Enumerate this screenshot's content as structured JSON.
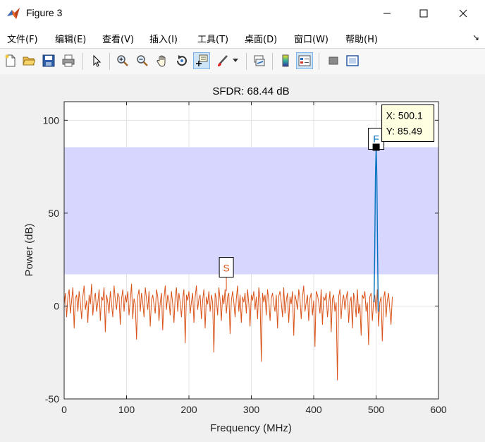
{
  "window": {
    "title": "Figure 3",
    "icon": "matlab-icon",
    "controls": [
      "minimize-icon",
      "maximize-icon",
      "close-icon"
    ]
  },
  "menu": {
    "items": [
      {
        "label": "文件(F)"
      },
      {
        "label": "编辑(E)"
      },
      {
        "label": "查看(V)"
      },
      {
        "label": "插入(I)"
      },
      {
        "label": "工具(T)"
      },
      {
        "label": "桌面(D)"
      },
      {
        "label": "窗口(W)"
      },
      {
        "label": "帮助(H)"
      }
    ],
    "overflow": "↘"
  },
  "toolbar": {
    "tools": [
      "new-figure-icon",
      "open-file-icon",
      "save-icon",
      "print-icon",
      "pointer-icon",
      "zoom-in-icon",
      "zoom-out-icon",
      "pan-icon",
      "rotate-icon",
      "data-cursor-icon",
      "brush-icon",
      "brush-dropdown-icon",
      "link-plot-icon",
      "colorbar-icon",
      "legend-icon",
      "hide-plot-tools-icon",
      "show-plot-tools-icon"
    ],
    "active": "data-cursor-icon"
  },
  "chart_data": {
    "type": "line",
    "title": "SFDR:  68.44 dB",
    "xlabel": "Frequency (MHz)",
    "ylabel": "Power (dB)",
    "xlim": [
      0,
      600
    ],
    "ylim": [
      -50,
      110
    ],
    "xticks": [
      "0",
      "100",
      "200",
      "300",
      "400",
      "500",
      "600"
    ],
    "yticks": [
      "-50",
      "0",
      "50",
      "100"
    ],
    "grid": true,
    "colors": {
      "noise": "#d95319",
      "signal": "#0072bd",
      "band": "#d6d6ff"
    },
    "sfdr_band": {
      "y_low": 17.05,
      "y_high": 85.49
    },
    "signal": {
      "x": 500.1,
      "y": 85.49,
      "marker": "F"
    },
    "spur": {
      "x": 260,
      "y": 17.05,
      "marker": "S"
    },
    "datatip": {
      "x_label": "X: 500.1",
      "y_label": "Y: 85.49"
    },
    "noise_series": {
      "x_start": 0,
      "x_step": 2,
      "values": [
        1,
        7,
        -6,
        5,
        9,
        -4,
        3,
        10,
        -12,
        4,
        6,
        -3,
        8,
        2,
        -7,
        5,
        11,
        -2,
        3,
        -9,
        6,
        1,
        12,
        -5,
        4,
        7,
        -3,
        2,
        9,
        -8,
        5,
        3,
        10,
        -14,
        6,
        2,
        -4,
        8,
        1,
        -6,
        11,
        3,
        -2,
        7,
        5,
        -10,
        4,
        9,
        -3,
        6,
        2,
        8,
        -5,
        3,
        12,
        -7,
        4,
        1,
        -18,
        5,
        9,
        -3,
        7,
        2,
        -6,
        10,
        4,
        -2,
        8,
        -11,
        3,
        6,
        1,
        -4,
        9,
        5,
        -8,
        2,
        7,
        -13,
        4,
        11,
        -2,
        6,
        3,
        -5,
        8,
        1,
        -9,
        5,
        10,
        -3,
        7,
        2,
        -6,
        4,
        9,
        -20,
        6,
        3,
        8,
        -4,
        2,
        7,
        -9,
        5,
        11,
        -2,
        4,
        6,
        -7,
        3,
        9,
        -12,
        5,
        1,
        8,
        -3,
        6,
        2,
        -25,
        7,
        4,
        -5,
        10,
        3,
        -8,
        6,
        1,
        9,
        -4,
        5,
        7,
        -15,
        3,
        8,
        2,
        -6,
        4,
        11,
        -3,
        6,
        -9,
        5,
        2,
        7,
        -4,
        9,
        1,
        -11,
        6,
        3,
        8,
        -2,
        5,
        -7,
        10,
        4,
        -30,
        7,
        2,
        6,
        -5,
        9,
        3,
        -8,
        4,
        7,
        1,
        -3,
        6,
        -12,
        5,
        8,
        2,
        -6,
        10,
        -4,
        3,
        7,
        -9,
        5,
        1,
        8,
        -16,
        6,
        3,
        -2,
        9,
        4,
        -7,
        5,
        11,
        -3,
        2,
        6,
        -8,
        4,
        7,
        -5,
        3,
        -22,
        8,
        6,
        2,
        -4,
        9,
        -10,
        5,
        3,
        7,
        -6,
        1,
        8,
        -14,
        4,
        6,
        -3,
        2,
        -40,
        5,
        9,
        -7,
        3,
        6,
        -2,
        4,
        8,
        -9,
        2,
        5,
        -12,
        7,
        3,
        -6,
        9,
        -4,
        1,
        -16,
        6,
        4,
        8,
        -3,
        2,
        -21,
        5,
        7,
        -8,
        3,
        6,
        -4,
        9,
        -11,
        2,
        5,
        -19,
        4,
        8,
        -6,
        3,
        7,
        -2,
        -10,
        5
      ]
    }
  }
}
